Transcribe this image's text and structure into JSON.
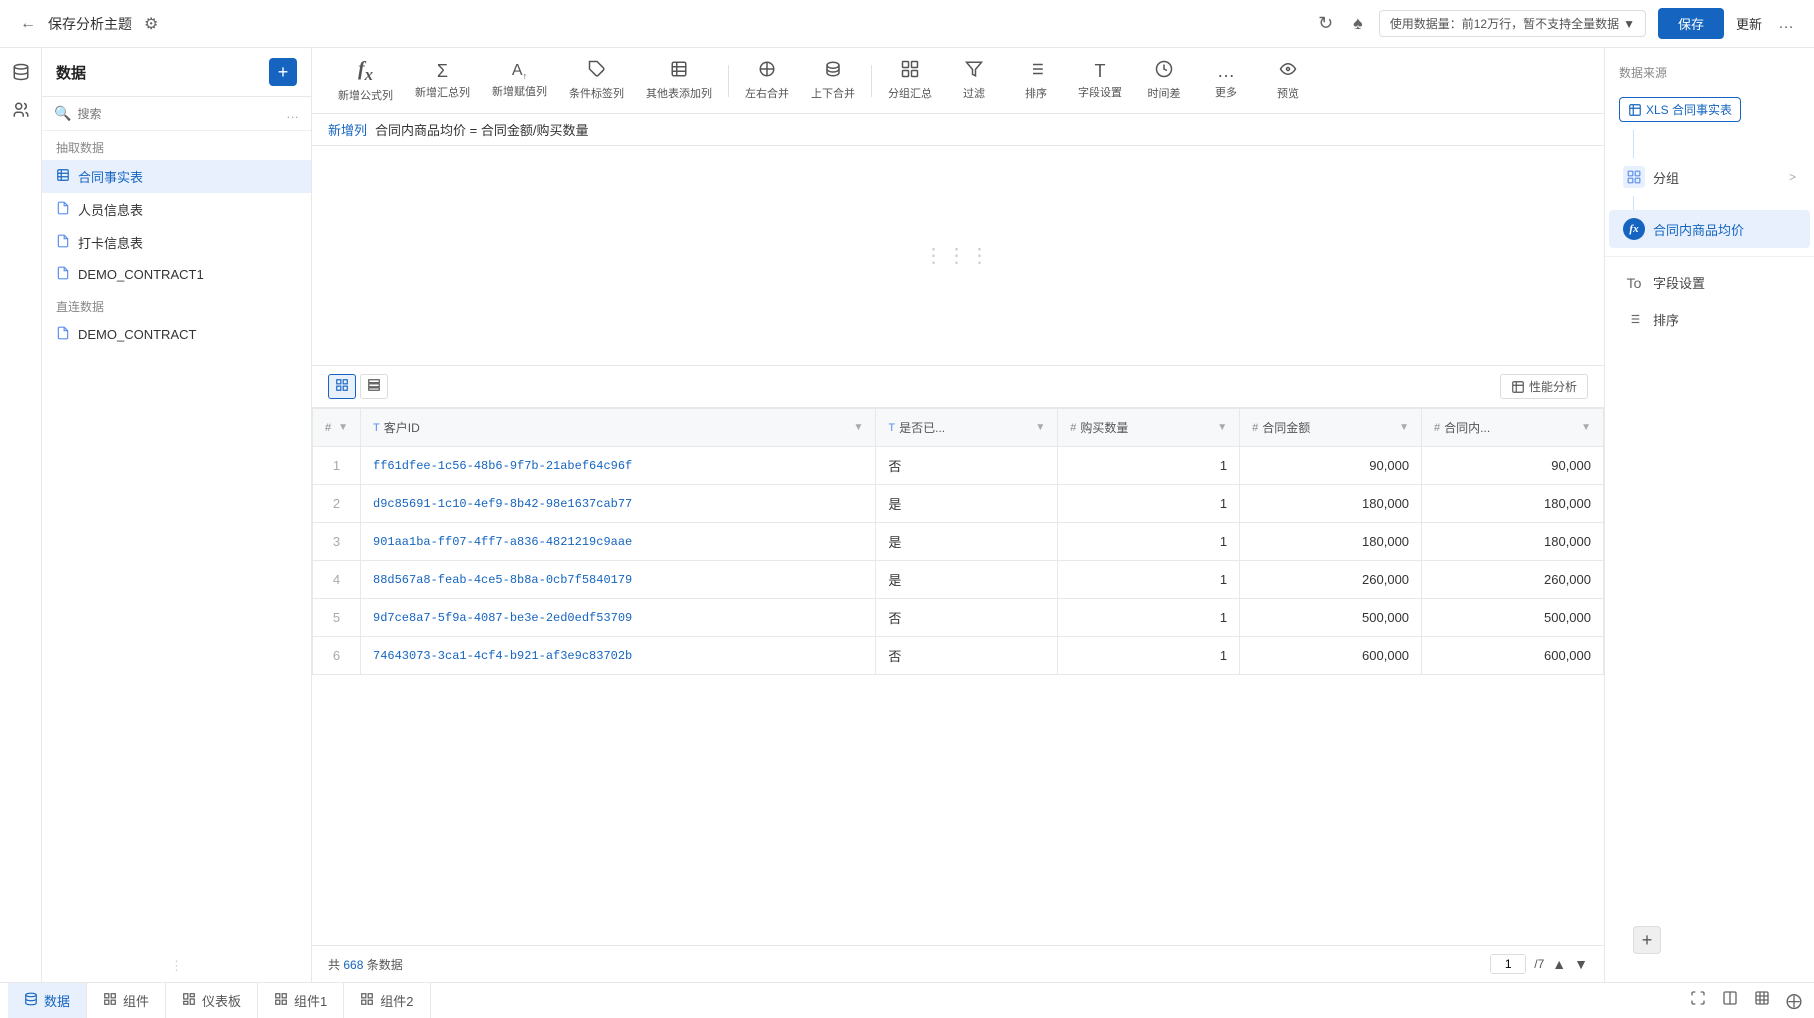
{
  "header": {
    "title": "保存分析主题",
    "data_usage": "使用数据量：前12万行，暂不支持全量数据",
    "save_label": "保存",
    "update_label": "更新"
  },
  "toolbar": {
    "items": [
      {
        "id": "formula-col",
        "icon": "fx",
        "label": "新增公式列"
      },
      {
        "id": "sum-col",
        "icon": "Σ",
        "label": "新增汇总列"
      },
      {
        "id": "assign-col",
        "icon": "A+",
        "label": "新增赋值列"
      },
      {
        "id": "condition-tag",
        "icon": "tag",
        "label": "条件标签列"
      },
      {
        "id": "add-table",
        "icon": "grid+",
        "label": "其他表添加列"
      },
      {
        "id": "lr-merge",
        "icon": "lr",
        "label": "左右合并"
      },
      {
        "id": "tb-merge",
        "icon": "tb",
        "label": "上下合并"
      },
      {
        "id": "group-sum",
        "icon": "group",
        "label": "分组汇总"
      },
      {
        "id": "filter",
        "icon": "filter",
        "label": "过滤"
      },
      {
        "id": "sort",
        "icon": "sort",
        "label": "排序"
      },
      {
        "id": "field-set",
        "icon": "field",
        "label": "字段设置"
      },
      {
        "id": "time-diff",
        "icon": "clock",
        "label": "时间差"
      },
      {
        "id": "more",
        "icon": "...",
        "label": "更多"
      },
      {
        "id": "preview",
        "icon": "eye",
        "label": "预览"
      }
    ]
  },
  "formula_bar": {
    "label": "新增列",
    "formula": "合同内商品均价 = 合同金额/购买数量"
  },
  "left_panel": {
    "title": "数据",
    "search_placeholder": "搜索",
    "extract_section": "抽取数据",
    "extract_items": [
      {
        "id": "contract-fact",
        "label": "合同事实表",
        "icon": "table",
        "active": true
      },
      {
        "id": "personnel",
        "label": "人员信息表",
        "icon": "file"
      },
      {
        "id": "checkin",
        "label": "打卡信息表",
        "icon": "file"
      },
      {
        "id": "demo-contract1",
        "label": "DEMO_CONTRACT1",
        "icon": "file"
      }
    ],
    "direct_section": "直连数据",
    "direct_items": [
      {
        "id": "demo-contract",
        "label": "DEMO_CONTRACT",
        "icon": "file"
      }
    ]
  },
  "table": {
    "columns": [
      {
        "id": "num",
        "type": "#",
        "label": "",
        "sortable": true
      },
      {
        "id": "customer-id",
        "type": "T",
        "label": "客户ID",
        "sortable": true
      },
      {
        "id": "is-yes",
        "type": "T",
        "label": "是否已...",
        "sortable": true
      },
      {
        "id": "purchase-qty",
        "type": "#",
        "label": "购买数量",
        "sortable": true
      },
      {
        "id": "contract-amount",
        "type": "#",
        "label": "合同金额",
        "sortable": true
      },
      {
        "id": "contract-avg",
        "type": "#",
        "label": "合同内...",
        "sortable": true
      }
    ],
    "rows": [
      {
        "customer_id": "ff61dfee-1c56-48b6-9f7b-21abef64c96f",
        "is_yes": "否",
        "purchase_qty": "1",
        "contract_amount": "90,000",
        "contract_avg": "90,000"
      },
      {
        "customer_id": "d9c85691-1c10-4ef9-8b42-98e1637cab77",
        "is_yes": "是",
        "purchase_qty": "1",
        "contract_amount": "180,000",
        "contract_avg": "180,000"
      },
      {
        "customer_id": "901aa1ba-ff07-4ff7-a836-4821219c9aae",
        "is_yes": "是",
        "purchase_qty": "1",
        "contract_amount": "180,000",
        "contract_avg": "180,000"
      },
      {
        "customer_id": "88d567a8-feab-4ce5-8b8a-0cb7f5840179",
        "is_yes": "是",
        "purchase_qty": "1",
        "contract_amount": "260,000",
        "contract_avg": "260,000"
      },
      {
        "customer_id": "9d7ce8a7-5f9a-4087-be3e-2ed0edf53709",
        "is_yes": "否",
        "purchase_qty": "1",
        "contract_amount": "500,000",
        "contract_avg": "500,000"
      },
      {
        "customer_id": "74643073-3ca1-4cf4-b921-af3e9c83702b",
        "is_yes": "否",
        "purchase_qty": "1",
        "contract_amount": "600,000",
        "contract_avg": "600,000"
      }
    ],
    "total_label": "共",
    "total_count": "668",
    "total_unit": "条数据",
    "current_page": "1",
    "total_pages": "/7"
  },
  "right_panel": {
    "source_title": "数据来源",
    "source_tag": "XLS 合同事实表",
    "items": [
      {
        "id": "group",
        "icon": "group",
        "label": "分组",
        "active": false,
        "has_arrow": true
      },
      {
        "id": "formula-field",
        "icon": "fx",
        "label": "合同内商品均价",
        "active": true,
        "has_arrow": false
      },
      {
        "id": "field-setting",
        "icon": "T",
        "label": "字段设置",
        "active": false,
        "has_arrow": false
      },
      {
        "id": "sort-right",
        "icon": "sort",
        "label": "排序",
        "active": false,
        "has_arrow": false
      }
    ]
  },
  "bottom_tabs": {
    "tabs": [
      {
        "id": "data",
        "icon": "db",
        "label": "数据",
        "active": true
      },
      {
        "id": "component",
        "icon": "widget",
        "label": "组件",
        "active": false
      },
      {
        "id": "dashboard",
        "icon": "dashboard",
        "label": "仪表板",
        "active": false
      },
      {
        "id": "component1",
        "icon": "widget",
        "label": "组件1",
        "active": false
      },
      {
        "id": "component2",
        "icon": "widget",
        "label": "组件2",
        "active": false
      }
    ]
  },
  "perf_analysis": "性能分析"
}
